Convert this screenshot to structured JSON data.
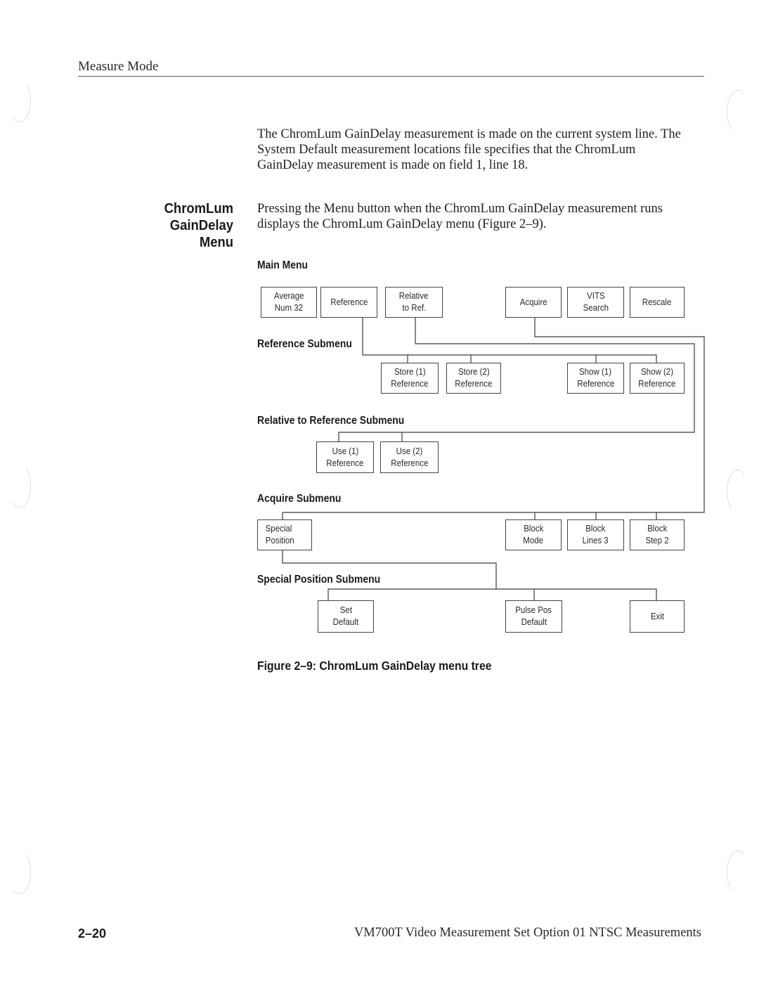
{
  "header": {
    "running_head": "Measure Mode"
  },
  "intro_paragraph": "The ChromLum GainDelay measurement is made on the current system line. The System Default measurement locations file specifies that the ChromLum GainDelay measurement is made on field 1, line 18.",
  "section": {
    "heading_line1": "ChromLum GainDelay",
    "heading_line2": "Menu",
    "paragraph": "Pressing the Menu button when the ChromLum GainDelay measurement runs displays the ChromLum GainDelay menu (Figure 2–9)."
  },
  "menu_tree": {
    "main_menu": {
      "label": "Main Menu",
      "items": [
        {
          "line1": "Average",
          "line2": "Num 32"
        },
        {
          "line1": "Reference",
          "line2": ""
        },
        {
          "line1": "Relative",
          "line2": "to Ref."
        },
        {
          "line1": "Acquire",
          "line2": ""
        },
        {
          "line1": "VITS",
          "line2": "Search"
        },
        {
          "line1": "Rescale",
          "line2": ""
        }
      ]
    },
    "reference_submenu": {
      "label": "Reference Submenu",
      "items": [
        {
          "line1": "Store (1)",
          "line2": "Reference"
        },
        {
          "line1": "Store (2)",
          "line2": "Reference"
        },
        {
          "line1": "Show (1)",
          "line2": "Reference"
        },
        {
          "line1": "Show (2)",
          "line2": "Reference"
        }
      ]
    },
    "relative_submenu": {
      "label": "Relative to Reference Submenu",
      "items": [
        {
          "line1": "Use (1)",
          "line2": "Reference"
        },
        {
          "line1": "Use (2)",
          "line2": "Reference"
        }
      ]
    },
    "acquire_submenu": {
      "label": "Acquire Submenu",
      "items": [
        {
          "line1": "Special",
          "line2": "Position"
        },
        {
          "line1": "Block",
          "line2": "Mode"
        },
        {
          "line1": "Block",
          "line2": "Lines 3"
        },
        {
          "line1": "Block",
          "line2": "Step 2"
        }
      ]
    },
    "special_position_submenu": {
      "label": "Special Position Submenu",
      "items": [
        {
          "line1": "Set",
          "line2": "Default"
        },
        {
          "line1": "Pulse Pos",
          "line2": "Default"
        },
        {
          "line1": "Exit",
          "line2": ""
        }
      ]
    }
  },
  "figure": {
    "caption": "Figure 2–9: ChromLum GainDelay menu tree"
  },
  "footer": {
    "page_number": "2–20",
    "title": "VM700T Video Measurement Set Option 01 NTSC Measurements"
  }
}
